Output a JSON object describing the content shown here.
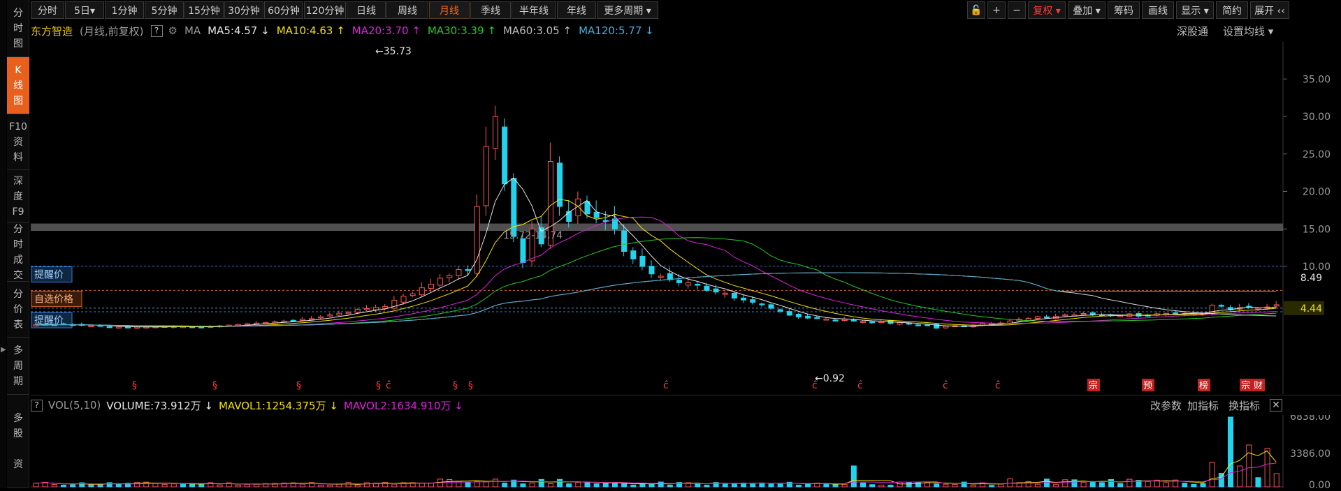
{
  "left_nav": [
    {
      "label": "分时图",
      "lines": [
        "分",
        "时",
        "图"
      ],
      "active": false
    },
    {
      "label": "K线图",
      "lines": [
        "K",
        "线",
        "图"
      ],
      "active": true
    },
    {
      "label": "F10资料",
      "lines": [
        "F10",
        "资",
        "料"
      ],
      "active": false
    },
    {
      "label": "深度F9",
      "lines": [
        "深",
        "度",
        "F9"
      ],
      "active": false
    },
    {
      "label": "分时成交",
      "lines": [
        "分",
        "时",
        "成",
        "交"
      ],
      "active": false
    },
    {
      "label": "分价表",
      "lines": [
        "分",
        "价",
        "表"
      ],
      "active": false
    },
    {
      "label": "多周期",
      "lines": [
        "多",
        "周",
        "期"
      ],
      "active": false
    },
    {
      "label": "多股资",
      "lines": [
        "多",
        "股",
        "",
        "资"
      ],
      "active": false
    }
  ],
  "toolbar": {
    "periods": [
      "分时",
      "5日▾",
      "1分钟",
      "5分钟",
      "15分钟",
      "30分钟",
      "60分钟",
      "120分钟",
      "日线",
      "周线",
      "月线",
      "季线",
      "半年线",
      "年线",
      "更多周期 ▾"
    ],
    "active_period": "月线",
    "right_buttons": [
      "🔓",
      "+",
      "−",
      "复权 ▾",
      "叠加 ▾",
      "筹码",
      "画线",
      "显示 ▾",
      "简约",
      "展开 ‹‹"
    ],
    "fuquan_label": "复权 ▾"
  },
  "info": {
    "stock_name": "东方智造",
    "mode": "(月线,前复权)",
    "help": "?",
    "ma_label": "MA",
    "ma5": "MA5:4.57 ↓",
    "ma10": "MA10:4.63 ↑",
    "ma20": "MA20:3.70 ↑",
    "ma30": "MA30:3.39 ↑",
    "ma60": "MA60:3.05 ↑",
    "ma120": "MA120:5.77 ↓",
    "shengutong": "深股通",
    "set_ma": "设置均线 ▾"
  },
  "colors": {
    "up": "#ff5555",
    "down": "#22d3ee",
    "ma5": "#e6e6e6",
    "ma10": "#f5e000",
    "ma20": "#e020e0",
    "ma30": "#22cc22",
    "ma60": "#a8a8a8",
    "ma120": "#4aa8c8",
    "accent": "#e8601c"
  },
  "price_axis": {
    "ticks": [
      "35.00",
      "30.00",
      "25.00",
      "20.00",
      "15.00",
      "10.00"
    ],
    "current_price": "8.49",
    "current_price2": "4.44"
  },
  "annotations": {
    "high": "←35.73",
    "low": "←0.92",
    "zone": "15.72-14.74",
    "alert_high": "提醒价",
    "custom_price": "自选价格",
    "alert_low": "提醒价"
  },
  "markers": {
    "s": "§",
    "c": "ĉ",
    "zong": "宗",
    "yu": "预",
    "bang": "榜",
    "cai": "财"
  },
  "volume": {
    "label": "VOL(5,10)",
    "volume": "VOLUME:73.912万 ↓",
    "mavol1": "MAVOL1:1254.375万 ↓",
    "mavol2": "MAVOL2:1634.910万 ↓",
    "change_params": "改参数",
    "add_indicator": "加指标",
    "switch_indicator": "换指标",
    "close": "✕",
    "ticks": [
      "6838.00",
      "3386.00",
      "0.00"
    ]
  }
}
